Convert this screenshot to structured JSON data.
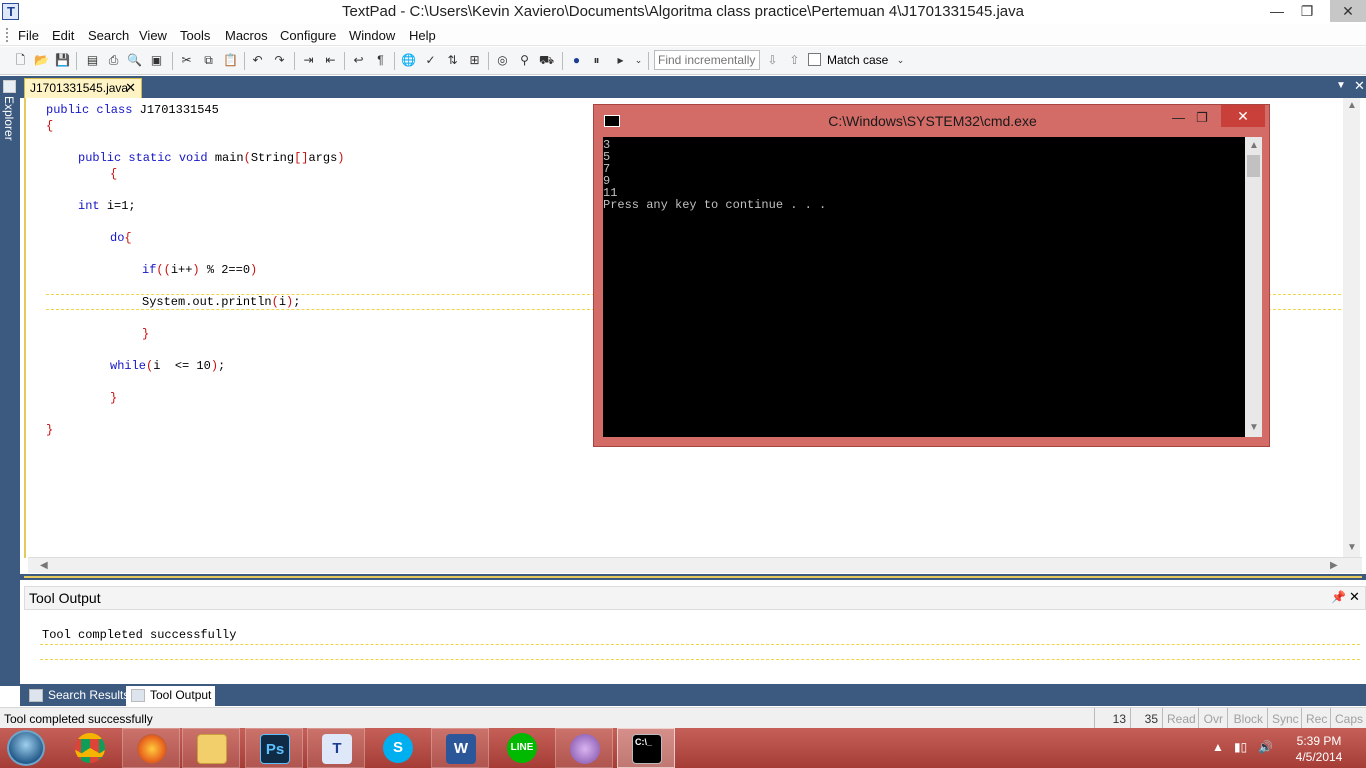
{
  "window": {
    "title": "TextPad - C:\\Users\\Kevin Xaviero\\Documents\\Algoritma class practice\\Pertemuan 4\\J1701331545.java",
    "min": "—",
    "max": "❐",
    "close": "✕"
  },
  "menu": [
    "File",
    "Edit",
    "Search",
    "View",
    "Tools",
    "Macros",
    "Configure",
    "Window",
    "Help"
  ],
  "toolbar": {
    "find_placeholder": "Find incrementally",
    "match_case": "Match case"
  },
  "explorer": {
    "label": "Explorer"
  },
  "doc_tab": {
    "label": "J1701331545.java",
    "close": "✕"
  },
  "code": {
    "l1a": "public class ",
    "l1b": "J1701331545",
    "l2": "{",
    "l3a": "public static void ",
    "l3b": "main",
    "l3c": "(",
    "l3d": "String",
    "l3e": "[]",
    "l3f": "args",
    "l3g": ")",
    "l4": "{",
    "l5a": "int ",
    "l5b": "i=1;",
    "l6a": "do",
    "l6b": "{",
    "l7a": "if",
    "l7b": "((",
    "l7c": "i++",
    "l7d": ")",
    "l7e": " % 2==0",
    "l7f": ")",
    "l8a": "System.out.println",
    "l8b": "(",
    "l8c": "i",
    "l8d": ")",
    "l8e": ";",
    "l9": "}",
    "l10a": "while",
    "l10b": "(",
    "l10c": "i  <= 10",
    "l10d": ")",
    "l10e": ";",
    "l11": "}",
    "l12": "}"
  },
  "tool_output": {
    "title": "Tool Output",
    "message": "Tool completed successfully"
  },
  "bottom_tabs": [
    "Search Results",
    "Tool Output"
  ],
  "status": {
    "message": "Tool completed successfully",
    "line": "13",
    "col": "35",
    "read": "Read",
    "ovr": "Ovr",
    "block": "Block",
    "sync": "Sync",
    "rec": "Rec",
    "caps": "Caps"
  },
  "cmd": {
    "title": "C:\\Windows\\SYSTEM32\\cmd.exe",
    "lines": [
      "3",
      "5",
      "7",
      "9",
      "11",
      "Press any key to continue . . ."
    ]
  },
  "taskbar": {
    "apps": [
      "start",
      "chrome",
      "firefox",
      "explorer",
      "photoshop",
      "textpad",
      "skype",
      "word",
      "line",
      "messenger",
      "cmd"
    ],
    "time": "5:39 PM",
    "date": "4/5/2014"
  },
  "colors": {
    "keyword": "#1515c8",
    "bracket": "#c81010",
    "panel_blue": "#3c5a80",
    "cmd_frame": "#d36b67",
    "taskbar": "#b5473f"
  }
}
